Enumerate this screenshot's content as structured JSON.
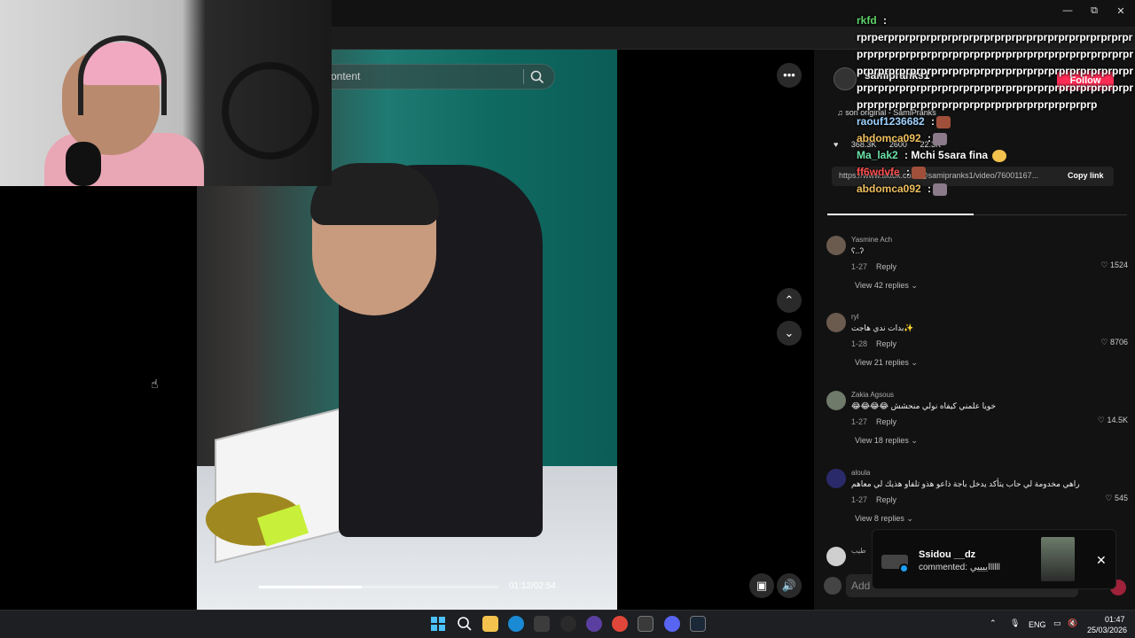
{
  "window": {
    "minimize": "—",
    "maximize": "⧉",
    "close": "✕"
  },
  "search": {
    "placeholder": "ontent"
  },
  "video": {
    "time": "01:12/02:54",
    "progress": 0.43
  },
  "creator": {
    "name": "samipranks1",
    "follow": "Follow",
    "sound": "son original - SamiPranks",
    "likes": "368.3K",
    "comments": "2600",
    "saves": "22.3K",
    "link": "https://www.tiktok.com/@samipranks1/video/76001167...",
    "copy": "Copy link"
  },
  "comments": [
    {
      "user": "Yasmine Ach",
      "text": "ʕ..ʔ",
      "date": "1-27",
      "reply": "Reply",
      "likes": "1524",
      "view": "View 42 replies",
      "avatar_color": "#7b4a3a"
    },
    {
      "user": "ryl",
      "text": "بدات ندي هاجت✨",
      "date": "1-28",
      "reply": "Reply",
      "likes": "8706",
      "view": "View 21 replies",
      "avatar_color": "#5b4636"
    },
    {
      "user": "Zakia Agsous",
      "text": "😂😂😂😂 خويا علمني كيفاه نولي منحشش",
      "date": "1-27",
      "reply": "Reply",
      "likes": "14.5K",
      "view": "View 18 replies",
      "avatar_color": "#6f7a6a"
    },
    {
      "user": "aloula",
      "text": "راهي مخدومة لي حاب يتأكد يدخل باجة ذاعو هذو تلفاو هذيك لي معاهم",
      "date": "1-27",
      "reply": "Reply",
      "likes": "545",
      "view": "View 8 replies",
      "avatar_color": "#2a2a6a"
    }
  ],
  "partial_comment": {
    "user": "طيب",
    "avatar_color": "#cfcfcf"
  },
  "input": {
    "placeholder": "Add"
  },
  "chat": [
    {
      "name": "rkfd",
      "sep": " :",
      "color": "#5fd36b",
      "text": ""
    },
    {
      "name": "",
      "sep": "",
      "color": "#ffffff",
      "text": "rprperprprprprprprprprprprprprprprprprprprprprprprprprprprprprprprprprprprprprprprprprprprprprprprprprprprprprprprprprprprprprprprprprprprprprprprprprprprprprprprprprprprprprprprprprprprprprprprprprprprprprprprprprprprprprprprprprprprprprprprprprprprprp"
    },
    {
      "name": "raouf1236682",
      "sep": " :",
      "color": "#9fd2ff",
      "text": ""
    },
    {
      "name": "abdomca092",
      "sep": " :",
      "color": "#f0c060",
      "text": ""
    },
    {
      "name": "Ma_lak2",
      "sep": " :",
      "color": "#6be3a8",
      "text": "Mchi 5sara fina"
    },
    {
      "name": "ff6wdvfe",
      "sep": " :",
      "color": "#ff5050",
      "text": ""
    },
    {
      "name": "abdomca092",
      "sep": " :",
      "color": "#f0c060",
      "text": ""
    }
  ],
  "notification": {
    "user": "Ssidou __dz",
    "message": "commented: ايييييlllll",
    "close": "✕"
  },
  "taskbar": {
    "lang": "ENG",
    "time": "01:47",
    "date": "25/03/2026"
  },
  "colors": {
    "panel": "#121212",
    "follow": "#fe2c55",
    "taskbar": "#1d1f22"
  },
  "icons": [
    "search-icon",
    "more-icon",
    "chevron-up-icon",
    "chevron-down-icon",
    "heart-icon",
    "close-icon",
    "volume-icon",
    "windows-start-icon"
  ]
}
